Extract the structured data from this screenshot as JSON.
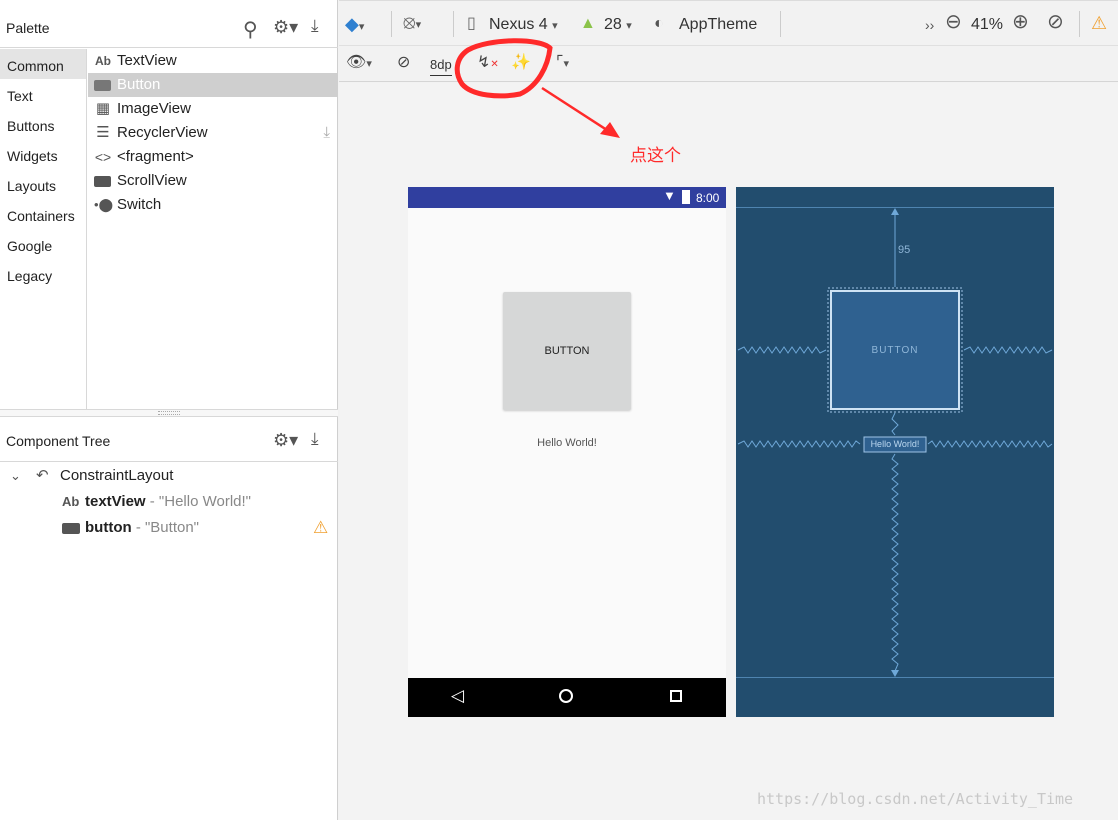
{
  "palette": {
    "title": "Palette",
    "categories": [
      "Common",
      "Text",
      "Buttons",
      "Widgets",
      "Layouts",
      "Containers",
      "Google",
      "Legacy"
    ],
    "selected_category": "Common",
    "items": [
      {
        "icon": "Ab",
        "label": "TextView"
      },
      {
        "icon": "button",
        "label": "Button"
      },
      {
        "icon": "image",
        "label": "ImageView"
      },
      {
        "icon": "list",
        "label": "RecyclerView"
      },
      {
        "icon": "code",
        "label": "<fragment>"
      },
      {
        "icon": "scroll",
        "label": "ScrollView"
      },
      {
        "icon": "switch",
        "label": "Switch"
      }
    ],
    "selected_item": "Button"
  },
  "component_tree": {
    "title": "Component Tree",
    "root": "ConstraintLayout",
    "children": [
      {
        "icon": "Ab",
        "id": "textView",
        "text": "- \"Hello World!\""
      },
      {
        "icon": "button",
        "id": "button",
        "text": "- \"Button\""
      }
    ]
  },
  "toolbar": {
    "device": "Nexus 4",
    "api": "28",
    "theme": "AppTheme",
    "zoom": "41%",
    "margin": "8dp",
    "more": "››"
  },
  "annotation": {
    "text": "点这个",
    "color": "#ff2a2a"
  },
  "preview": {
    "status_time": "8:00",
    "button_label": "BUTTON",
    "hello_text": "Hello World!"
  },
  "blueprint": {
    "top_margin": "95",
    "button_label": "BUTTON",
    "hello_text": "Hello World!"
  },
  "watermark": "https://blog.csdn.net/Activity_Time",
  "colors": {
    "status_bar": "#303f9f",
    "blueprint_bg": "#224d6e",
    "blueprint_line": "#6fa8d8",
    "accent": "#2f80d0",
    "warning": "#f0a030"
  }
}
